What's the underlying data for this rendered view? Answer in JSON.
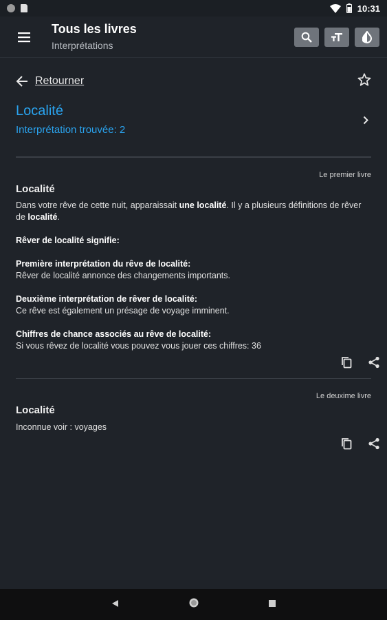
{
  "status_bar": {
    "time": "10:31"
  },
  "app_bar": {
    "title": "Tous les livres",
    "subtitle": "Interprétations",
    "icons": [
      "menu-icon",
      "search-icon",
      "text-size-icon",
      "contrast-icon"
    ]
  },
  "back": {
    "label": "Retourner"
  },
  "topic": {
    "title": "Localité",
    "count_text": "Interprétation trouvée: 2"
  },
  "entries": [
    {
      "source": "Le premier livre",
      "title": "Localité",
      "intro_1": "Dans votre rêve de cette nuit, apparaissait ",
      "intro_bold_1": "une localité",
      "intro_2": ". Il y a plusieurs définitions de rêver de ",
      "intro_bold_2": "localité",
      "intro_3": ".",
      "heading_main": "Rêver de localité signifie:",
      "heading_1": "Première interprétation du rêve de localité:",
      "text_1": "Rêver de localité annonce des changements importants.",
      "heading_2": "Deuxième interprétation de rêver de localité:",
      "text_2": "Ce rêve est également un présage de voyage imminent.",
      "heading_3": "Chiffres de chance associés au rêve de localité:",
      "text_3": "Si vous rêvez de localité vous pouvez vous jouer ces chiffres: 36"
    },
    {
      "source": "Le deuxime livre",
      "title": "Localité",
      "text": "Inconnue voir : voyages"
    }
  ],
  "colors": {
    "background": "#1f2329",
    "accent": "#2aa3ee",
    "action_button": "#6f747b",
    "nav_bar": "#0f0f10"
  }
}
